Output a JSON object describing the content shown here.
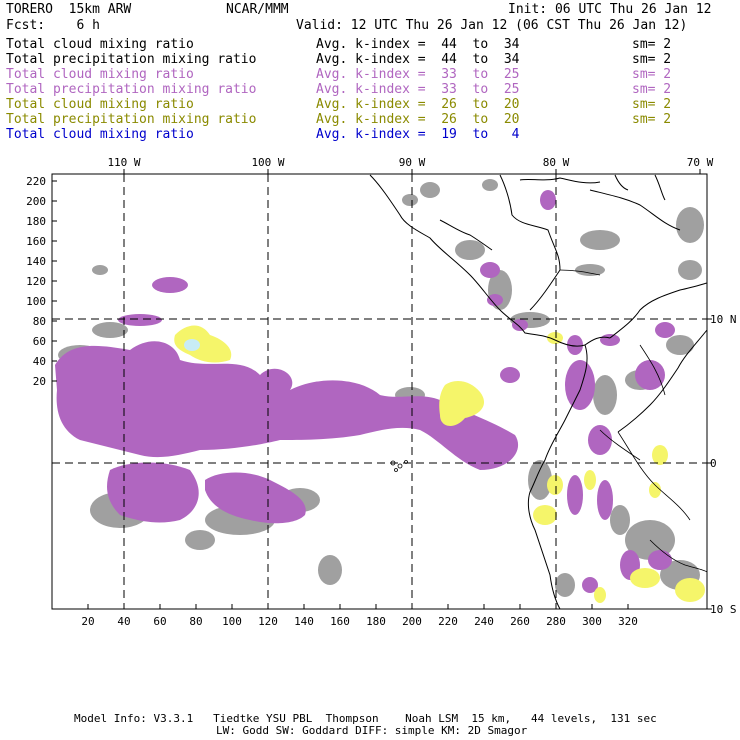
{
  "header": {
    "model": "TORERO  15km ARW",
    "center": "NCAR/MMM",
    "init": "Init: 06 UTC Thu 26 Jan 12",
    "fcst": "Fcst:    6 h",
    "valid": "Valid: 12 UTC Thu 26 Jan 12 (06 CST Thu 26 Jan 12)"
  },
  "legend": [
    {
      "field": "Total cloud mixing ratio",
      "kindex": "Avg. k-index =  44  to  34",
      "sm": "sm= 2",
      "color": "#000000"
    },
    {
      "field": "Total precipitation mixing ratio",
      "kindex": "Avg. k-index =  44  to  34",
      "sm": "sm= 2",
      "color": "#000000"
    },
    {
      "field": "Total cloud mixing ratio",
      "kindex": "Avg. k-index =  33  to  25",
      "sm": "sm= 2",
      "color": "#b066c0"
    },
    {
      "field": "Total precipitation mixing ratio",
      "kindex": "Avg. k-index =  33  to  25",
      "sm": "sm= 2",
      "color": "#b066c0"
    },
    {
      "field": "Total cloud mixing ratio",
      "kindex": "Avg. k-index =  26  to  20",
      "sm": "sm= 2",
      "color": "#8a8a00"
    },
    {
      "field": "Total precipitation mixing ratio",
      "kindex": "Avg. k-index =  26  to  20",
      "sm": "sm= 2",
      "color": "#8a8a00"
    },
    {
      "field": "Total cloud mixing ratio",
      "kindex": "Avg. k-index =  19  to   4",
      "sm": "",
      "color": "#0000cc"
    }
  ],
  "map": {
    "top_lon_labels": [
      "110 W",
      "100 W",
      "90 W",
      "80 W",
      "70 W"
    ],
    "right_lat_labels": [
      "10 N",
      "0",
      "10 S"
    ],
    "left_ticks": [
      "220",
      "200",
      "180",
      "160",
      "140",
      "120",
      "100",
      "80",
      "60",
      "40",
      "20"
    ],
    "bottom_ticks": [
      "20",
      "40",
      "60",
      "80",
      "100",
      "120",
      "140",
      "160",
      "180",
      "200",
      "220",
      "240",
      "260",
      "280",
      "300",
      "320"
    ],
    "colors": {
      "gray": "#a0a0a0",
      "purple": "#b066c0",
      "yellow": "#f5f56a",
      "cyan": "#c8ecf5",
      "darkgray": "#6e6e6e"
    }
  },
  "footer": {
    "line1": "Model Info: V3.3.1   Tiedtke YSU PBL  Thompson    Noah LSM  15 km,   44 levels,  131 sec",
    "line2": "LW: Godd SW: Goddard DIFF: simple KM: 2D Smagor"
  }
}
